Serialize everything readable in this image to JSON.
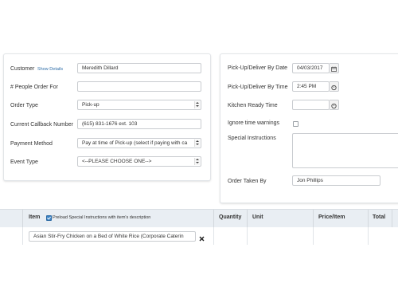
{
  "order_form": {
    "customer_label": "Customer",
    "show_details_link": "Show Details",
    "customer_value": "Meredith Dillard",
    "people_label": "# People Order For",
    "people_value": "",
    "order_type_label": "Order Type",
    "order_type_value": "Pick-up",
    "callback_label": "Current Callback Number",
    "callback_value": "(615) 831-1676 ext. 103",
    "payment_label": "Payment Method",
    "payment_value": "Pay at time of Pick-up (select if paying with ca",
    "event_label": "Event Type",
    "event_value": "<--PLEASE CHOOSE ONE-->"
  },
  "schedule": {
    "date_label": "Pick-Up/Deliver By Date",
    "date_value": "04/03/2017",
    "time_label": "Pick-Up/Deliver By Time",
    "time_value": "2:45 PM",
    "kitchen_label": "Kitchen Ready Time",
    "kitchen_value": "",
    "ignore_label": "Ignore time warnings",
    "instructions_label": "Special Instructions",
    "instructions_value": "",
    "taken_by_label": "Order Taken By",
    "taken_by_value": "Jon Phillips"
  },
  "items_table": {
    "columns": {
      "item": "Item",
      "preload": "Preload Special Instructions with item's description",
      "quantity": "Quantity",
      "unit": "Unit",
      "price": "Price/Item",
      "total": "Total"
    },
    "rows": [
      {
        "item": "Asian Stir-Fry Chicken on a Bed of White Rice (Corporate Caterin",
        "remove_icon": "close-icon"
      }
    ]
  },
  "icons": {
    "calendar": "calendar-icon",
    "clock": "clock-icon",
    "remove": "close-icon"
  },
  "colors": {
    "accent": "#3b82c4",
    "table_header_bg": "#e9eef3",
    "border": "#c9ccd0"
  }
}
